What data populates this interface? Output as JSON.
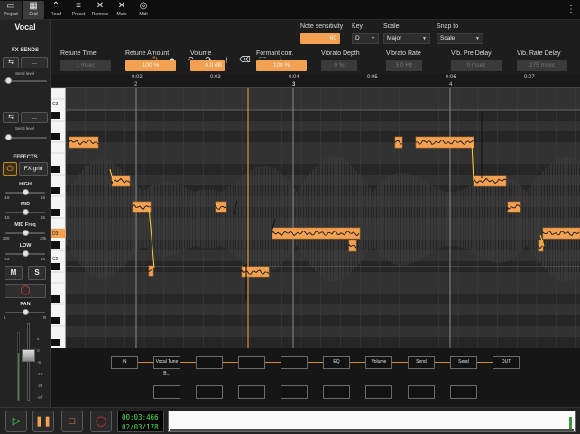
{
  "toolbar": {
    "items": [
      {
        "label": "Project",
        "icon": "folder-icon"
      },
      {
        "label": "Grid",
        "icon": "grid-icon"
      },
      {
        "label": "Read",
        "icon": "read-icon"
      },
      {
        "label": "Preset",
        "icon": "preset-icon"
      },
      {
        "label": "Remove",
        "icon": "remove-icon"
      },
      {
        "label": "Mute",
        "icon": "mute-icon"
      },
      {
        "label": "Midi",
        "icon": "midi-icon"
      }
    ],
    "menu_icon": "vertical-menu-icon"
  },
  "track": {
    "name": "Vocal",
    "fx_sends_title": "FX SENDS",
    "send1": {
      "button": "...",
      "label": "Send level",
      "level": 0.12
    },
    "send2": {
      "button": "...",
      "label": "Send level",
      "level": 0.12
    },
    "effects_title": "EFFECTS",
    "fx_grid_label": "FX grid",
    "eq": {
      "high": {
        "label": "HIGH",
        "min": "-15",
        "max": "15",
        "level": 0.5
      },
      "mid": {
        "label": "MID",
        "min": "-15",
        "max": "15",
        "level": 0.5
      },
      "mid_freq": {
        "label": "MID Freq",
        "min": "200",
        "max": "20k",
        "level": 0.5
      },
      "low": {
        "label": "LOW",
        "min": "-15",
        "max": "15",
        "level": 0.5
      }
    },
    "m_label": "M",
    "s_label": "S",
    "pan": {
      "label": "PAN",
      "left": "L",
      "right": "R",
      "level": 0.5
    },
    "fader_scale": [
      "6",
      "0",
      "-6",
      "-12",
      "-24",
      "-inf"
    ]
  },
  "controls": {
    "note_sensitivity": {
      "label": "Note sensitivity",
      "value": "60"
    },
    "key": {
      "label": "Key",
      "value": "D"
    },
    "scale": {
      "label": "Scale",
      "value": "Major"
    },
    "snap_to": {
      "label": "Snap to",
      "value": "Scale"
    },
    "params": [
      {
        "label": "Retune Time",
        "value": "1 msec",
        "active": false
      },
      {
        "label": "Retune Amount",
        "value": "100 %",
        "active": true
      },
      {
        "label": "Volume",
        "value": "0.0 dB",
        "active": true
      },
      {
        "label": "Formant corr.",
        "value": "100 %",
        "active": true
      },
      {
        "label": "Vibrato Depth",
        "value": "0 %",
        "active": false
      },
      {
        "label": "Vibrato Rate",
        "value": "5.0 Hz",
        "active": false
      },
      {
        "label": "Vib. Pre Delay",
        "value": "0 msec",
        "active": false
      },
      {
        "label": "Vib. Rate Delay",
        "value": "275 msec",
        "active": false
      }
    ]
  },
  "timeline": {
    "time_labels": [
      "0:02",
      "0:03",
      "0:04",
      "0:05",
      "0:06",
      "0:07"
    ],
    "bar_labels": [
      "2",
      "3",
      "4"
    ]
  },
  "piano": {
    "labels": [
      "C3",
      "D3",
      "C2"
    ],
    "highlight": "D3"
  },
  "fx_chain": [
    "IN",
    "Vocal Tune B...",
    "",
    "",
    "",
    "EQ",
    "Volume",
    "Send",
    "Send",
    "OUT"
  ],
  "transport": {
    "time": "00:03:466",
    "position": "02/03/178"
  },
  "colors": {
    "accent": "#f2a052",
    "note_fill": "#f2a052",
    "pitch_line": "#1a1a1a",
    "time_green": "#48e04c"
  }
}
